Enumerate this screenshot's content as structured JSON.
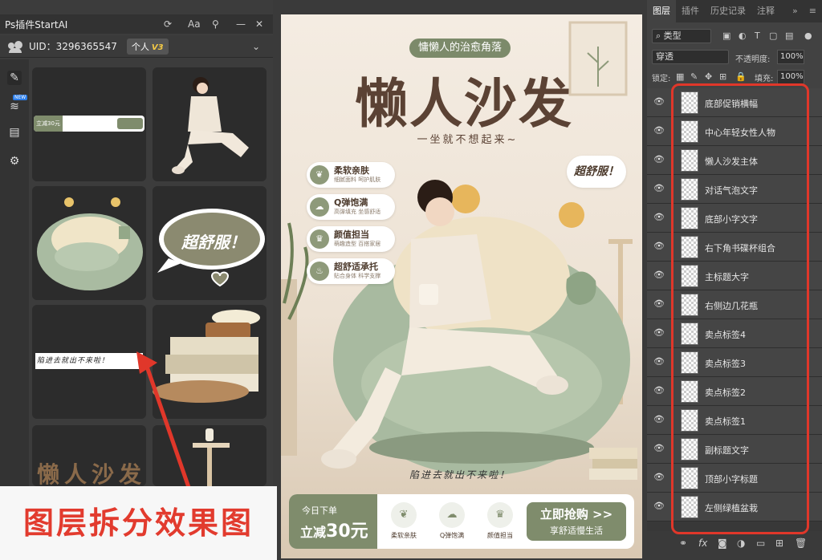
{
  "left_panel": {
    "title": "Ps插件StartAI",
    "uid": "UID：3296365547",
    "plan": "个人",
    "plan_tier": "V3",
    "new_badge": "NEW",
    "thumb_texts": {
      "banner_price": "立减30元",
      "bubble": "超舒服！",
      "scribble": "陷进去就出不来啦！",
      "title_preview": "懒人沙发"
    }
  },
  "overlay_caption": "图层拆分效果图",
  "canvas": {
    "top_badge": "慵懒人的治愈角落",
    "main_title": "懒人沙发",
    "subtitle": "一坐就不想起来~",
    "selling_points": [
      {
        "title": "柔软亲肤",
        "sub": "细腻面料 呵护肌肤",
        "icon": "leaf-icon"
      },
      {
        "title": "Q弹饱满",
        "sub": "高弹填充 坐感舒适",
        "icon": "cloud-icon"
      },
      {
        "title": "颜值担当",
        "sub": "萌趣造型 百搭家居",
        "icon": "crown-icon"
      },
      {
        "title": "超舒适承托",
        "sub": "贴合身体 科学支撑",
        "icon": "support-icon"
      }
    ],
    "bubble": "超舒服！",
    "scribble": "陷进去就出不来啦！",
    "bottom": {
      "today": "今日下单",
      "reduce": "立减",
      "amount": "30元",
      "icons": [
        "柔软亲肤",
        "Q弹饱满",
        "颜值担当"
      ],
      "cta_main": "立即抢购 >>",
      "cta_sub": "享舒适慢生活"
    }
  },
  "right_panel": {
    "tabs": [
      "图层",
      "插件",
      "历史记录",
      "注释"
    ],
    "active_tab": "图层",
    "kind": "类型",
    "blend": "穿透",
    "opacity_label": "不透明度:",
    "opacity": "100%",
    "lock_label": "锁定:",
    "fill_label": "填充:",
    "fill": "100%",
    "layers": [
      "底部促销横幅",
      "中心年轻女性人物",
      "懒人沙发主体",
      "对话气泡文字",
      "底部小字文字",
      "右下角书碟杯组合",
      "主标题大字",
      "右侧边几花瓶",
      "卖点标签4",
      "卖点标签3",
      "卖点标签2",
      "卖点标签1",
      "副标题文字",
      "顶部小字标题",
      "左侧绿植盆栽"
    ]
  },
  "colors": {
    "accent_green": "#7f8c6c",
    "title_brown": "#5b4234",
    "highlight_red": "#e0372a"
  }
}
